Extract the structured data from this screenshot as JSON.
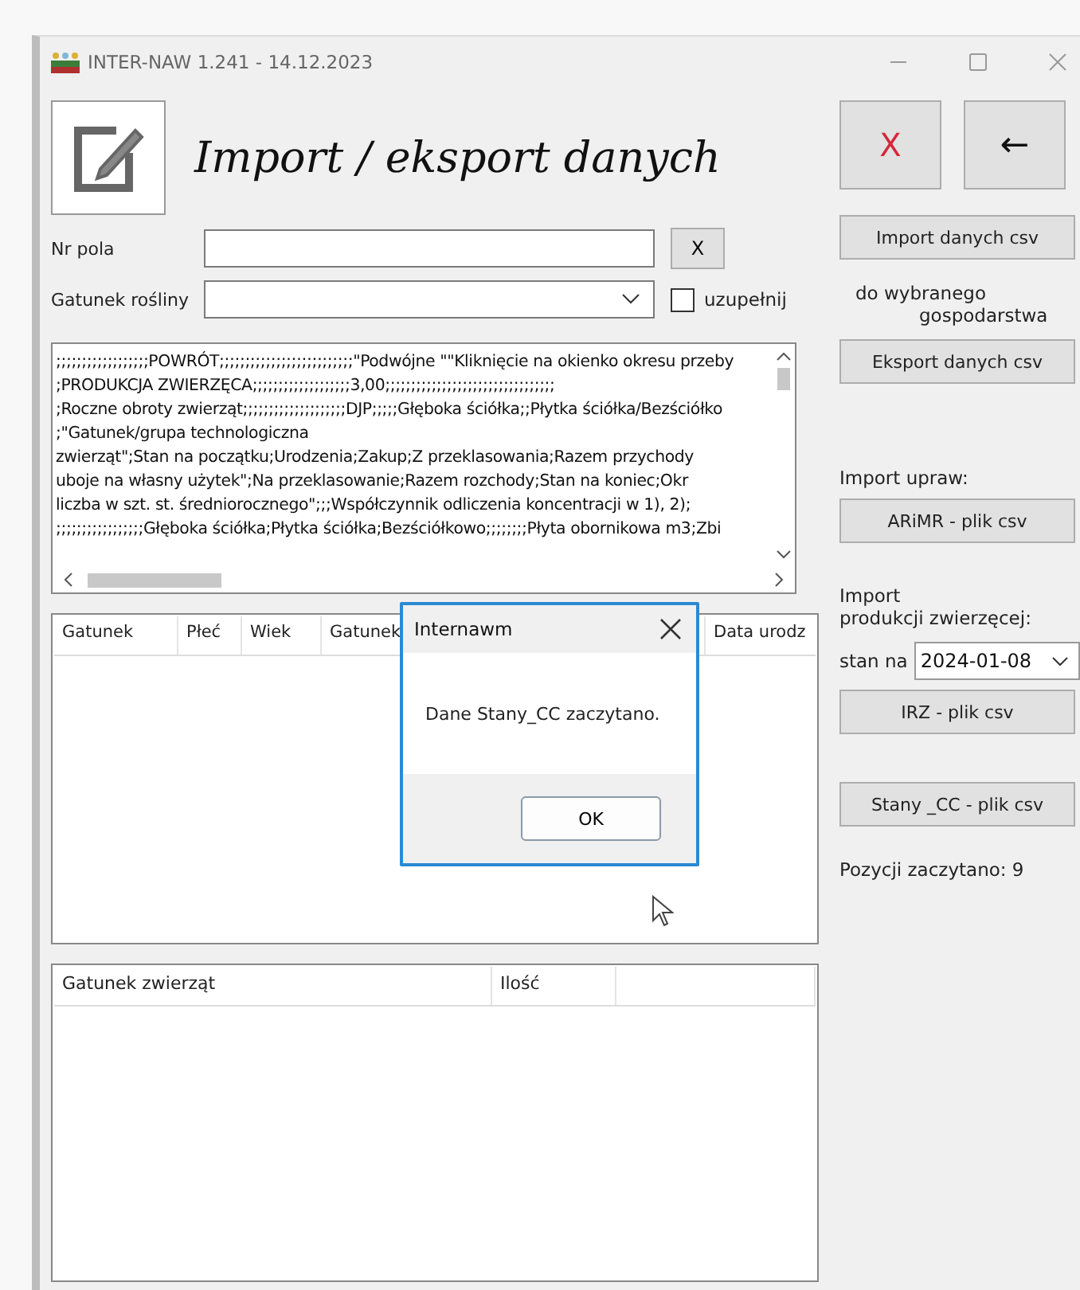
{
  "window": {
    "title": "INTER-NAW 1.241 - 14.12.2023"
  },
  "header": {
    "title": "Import / eksport danych",
    "close_button": "X",
    "back_button": "←"
  },
  "form": {
    "field_label": "Nr pola",
    "clear_button": "X",
    "plant_label": "Gatunek rośliny",
    "complete_checkbox": {
      "label": "uzupełnij",
      "checked": false
    }
  },
  "csv_text": [
    ";;;;;;;;;;;;;;;;;;POWRÓT;;;;;;;;;;;;;;;;;;;;;;;;;;\"Podwójne \"\"Kliknięcie na okienko okresu przeby",
    ";PRODUKCJA ZWIERZĘCA;;;;;;;;;;;;;;;;;;;3,00;;;;;;;;;;;;;;;;;;;;;;;;;;;;;;;;;",
    ";Roczne obroty zwierząt;;;;;;;;;;;;;;;;;;;;DJP;;;;;Głęboka ściółka;;Płytka ściółka/Bezściółko",
    ";\"Gatunek/grupa technologiczna",
    "zwierząt\";Stan na początku;Urodzenia;Zakup;Z przeklasowania;Razem przychody",
    "uboje na własny użytek\";Na przeklasowanie;Razem rozchody;Stan na koniec;Okr",
    "liczba w szt. st. średniorocznego\";;;Współczynnik odliczenia koncentracji w 1), 2);",
    ";;;;;;;;;;;;;;;;;Głęboka ściółka;Płytka ściółka;Bezściółkowo;;;;;;;;Płyta obornikowa m3;Zbi"
  ],
  "animals_table": {
    "columns": [
      "Gatunek",
      "Płeć",
      "Wiek",
      "Gatunek",
      "Data urodz"
    ]
  },
  "dialog": {
    "title": "Internawm",
    "message": "Dane Stany_CC zaczytano.",
    "ok_button": "OK"
  },
  "totals_table": {
    "columns": [
      "Gatunek zwierząt",
      "Ilość"
    ]
  },
  "side": {
    "import_button": "Import danych csv",
    "target_line1": "do wybranego",
    "target_line2": "gospodarstwa",
    "export_button": "Eksport danych csv",
    "crops_label": "Import upraw:",
    "arimr_button": "ARiMR - plik csv",
    "animal_label1": "Import",
    "animal_label2": "produkcji zwierzęcej:",
    "date_label": "stan na",
    "date_value": "2024-01-08",
    "irz_button": "IRZ - plik csv",
    "stany_button": "Stany _CC - plik csv",
    "loaded_count": "Pozycji zaczytano: 9"
  }
}
